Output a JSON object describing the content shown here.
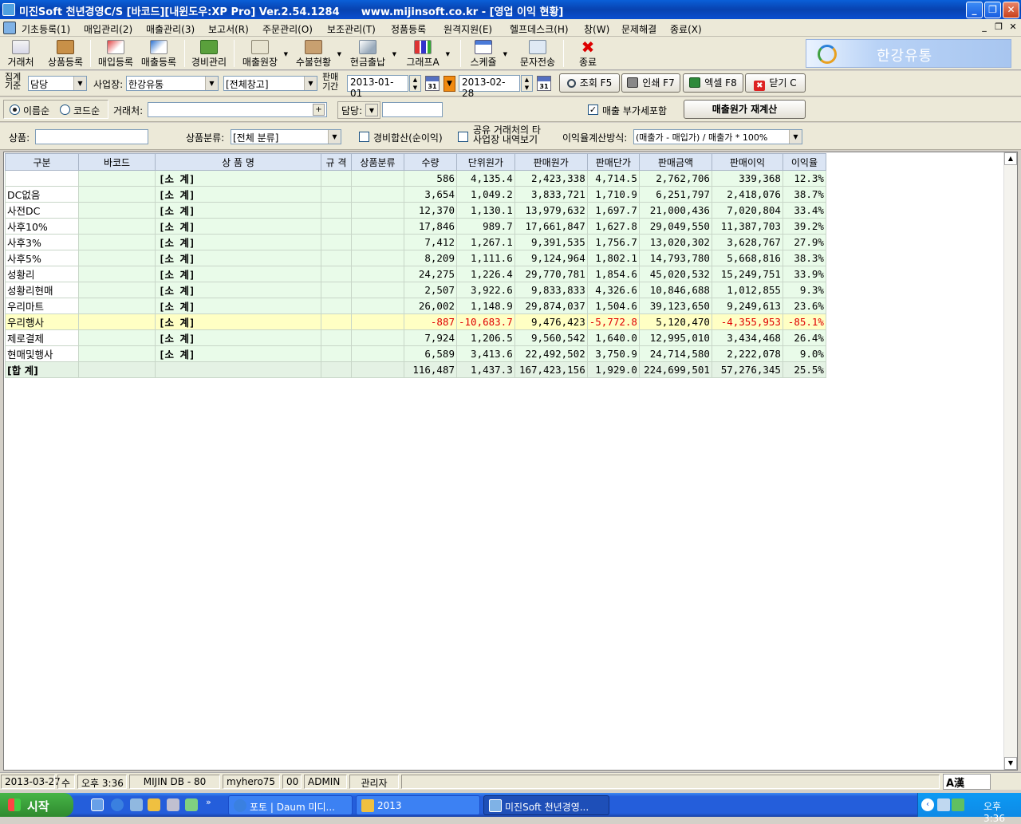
{
  "window": {
    "title": "미진Soft 천년경영C/S [바코드][내윈도우:XP Pro] Ver.2.54.1284      www.mijinsoft.co.kr - [영업 이익 현황]",
    "min": "_",
    "max": "❐",
    "close": "✕"
  },
  "menu": [
    "기초등록(1)",
    "매입관리(2)",
    "매출관리(3)",
    "보고서(R)",
    "주문관리(O)",
    "보조관리(T)",
    "정품등록",
    "원격지원(E)",
    "헬프데스크(H)",
    "창(W)",
    "문제해결",
    "종료(X)"
  ],
  "mdi": {
    "min": "_",
    "restore": "❐",
    "close": "✕"
  },
  "toolbar": [
    "거래처",
    "상품등록",
    "매입등록",
    "매출등록",
    "경비관리",
    "매출원장",
    "수불현황",
    "현금출납",
    "그래프A",
    "스케쥴",
    "문자전송",
    "종료"
  ],
  "brand": "한강유통",
  "filters": {
    "group_label": "집계\n기준",
    "group_value": "담당",
    "site_label": "사업장:",
    "site_value": "한강유통",
    "warehouse": "[전체창고]",
    "period_label": "판매\n기간",
    "date_from": "2013-01-01",
    "date_to": "2013-02-28",
    "cal": "31",
    "btn_query": "조회 F5",
    "btn_print": "인쇄 F7",
    "btn_excel": "엑셀 F8",
    "btn_close": "닫기 C",
    "sort_name": "이름순",
    "sort_code": "코드순",
    "client_label": "거래처:",
    "client_btn": "+",
    "manager_label": "담당:",
    "vat_label": "매출 부가세포함",
    "recalc_btn": "매출원가 재계산",
    "product_label": "상품:",
    "category_label": "상품분류:",
    "category_value": "[전체 분류]",
    "expense_label": "경비합산(순이익)",
    "shared_label": "공유 거래처의 타\n사업장 내역보기",
    "method_label": "이익율계산방식:",
    "method_value": "(매출가 - 매입가) / 매출가 * 100%"
  },
  "table": {
    "columns": [
      "구분",
      "바코드",
      "상 품 명",
      "규 격",
      "상품분류",
      "수량",
      "단위원가",
      "판매원가",
      "판매단가",
      "판매금액",
      "판매이익",
      "이익율"
    ],
    "rows": [
      {
        "g": "",
        "bc": "",
        "nm": "[소 계]",
        "qty": "586",
        "uc": "4,135.4",
        "sc": "2,423,338",
        "up": "4,714.5",
        "amt": "2,762,706",
        "pf": "339,368",
        "rt": "12.3%"
      },
      {
        "g": "DC없음",
        "bc": "",
        "nm": "[소 계]",
        "qty": "3,654",
        "uc": "1,049.2",
        "sc": "3,833,721",
        "up": "1,710.9",
        "amt": "6,251,797",
        "pf": "2,418,076",
        "rt": "38.7%"
      },
      {
        "g": "사전DC",
        "bc": "",
        "nm": "[소 계]",
        "qty": "12,370",
        "uc": "1,130.1",
        "sc": "13,979,632",
        "up": "1,697.7",
        "amt": "21,000,436",
        "pf": "7,020,804",
        "rt": "33.4%"
      },
      {
        "g": "사후10%",
        "bc": "",
        "nm": "[소 계]",
        "qty": "17,846",
        "uc": "989.7",
        "sc": "17,661,847",
        "up": "1,627.8",
        "amt": "29,049,550",
        "pf": "11,387,703",
        "rt": "39.2%"
      },
      {
        "g": "사후3%",
        "bc": "",
        "nm": "[소 계]",
        "qty": "7,412",
        "uc": "1,267.1",
        "sc": "9,391,535",
        "up": "1,756.7",
        "amt": "13,020,302",
        "pf": "3,628,767",
        "rt": "27.9%"
      },
      {
        "g": "사후5%",
        "bc": "",
        "nm": "[소 계]",
        "qty": "8,209",
        "uc": "1,111.6",
        "sc": "9,124,964",
        "up": "1,802.1",
        "amt": "14,793,780",
        "pf": "5,668,816",
        "rt": "38.3%"
      },
      {
        "g": "성황리",
        "bc": "",
        "nm": "[소 계]",
        "qty": "24,275",
        "uc": "1,226.4",
        "sc": "29,770,781",
        "up": "1,854.6",
        "amt": "45,020,532",
        "pf": "15,249,751",
        "rt": "33.9%"
      },
      {
        "g": "성황리현매",
        "bc": "",
        "nm": "[소 계]",
        "qty": "2,507",
        "uc": "3,922.6",
        "sc": "9,833,833",
        "up": "4,326.6",
        "amt": "10,846,688",
        "pf": "1,012,855",
        "rt": "9.3%"
      },
      {
        "g": "우리마트",
        "bc": "",
        "nm": "[소 계]",
        "qty": "26,002",
        "uc": "1,148.9",
        "sc": "29,874,037",
        "up": "1,504.6",
        "amt": "39,123,650",
        "pf": "9,249,613",
        "rt": "23.6%"
      },
      {
        "g": "우리행사",
        "bc": "",
        "nm": "[소 계]",
        "qty": "-887",
        "uc": "-10,683.7",
        "sc": "9,476,423",
        "up": "-5,772.8",
        "amt": "5,120,470",
        "pf": "-4,355,953",
        "rt": "-85.1%"
      },
      {
        "g": "제로결제",
        "bc": "",
        "nm": "[소 계]",
        "qty": "7,924",
        "uc": "1,206.5",
        "sc": "9,560,542",
        "up": "1,640.0",
        "amt": "12,995,010",
        "pf": "3,434,468",
        "rt": "26.4%"
      },
      {
        "g": "현매및행사",
        "bc": "",
        "nm": "[소 계]",
        "qty": "6,589",
        "uc": "3,413.6",
        "sc": "22,492,502",
        "up": "3,750.9",
        "amt": "24,714,580",
        "pf": "2,222,078",
        "rt": "9.0%"
      }
    ],
    "total": {
      "g": "[합 계]",
      "qty": "116,487",
      "uc": "1,437.3",
      "sc": "167,423,156",
      "up": "1,929.0",
      "amt": "224,699,501",
      "pf": "57,276,345",
      "rt": "25.5%"
    },
    "highlight_color": "#ffffc4",
    "negative_color": "#e00000"
  },
  "status": [
    "2013-03-27",
    "수",
    "오후 3:36",
    "MIJIN DB - 80",
    "myhero75",
    "00",
    "ADMIN",
    "관리자"
  ],
  "ime": "A漢",
  "taskbar": {
    "start": "시작",
    "more": "»",
    "tasks": [
      "포토 | Daum 미디...",
      "2013",
      "미진Soft 천년경영..."
    ],
    "clock": "오후 3:36"
  }
}
